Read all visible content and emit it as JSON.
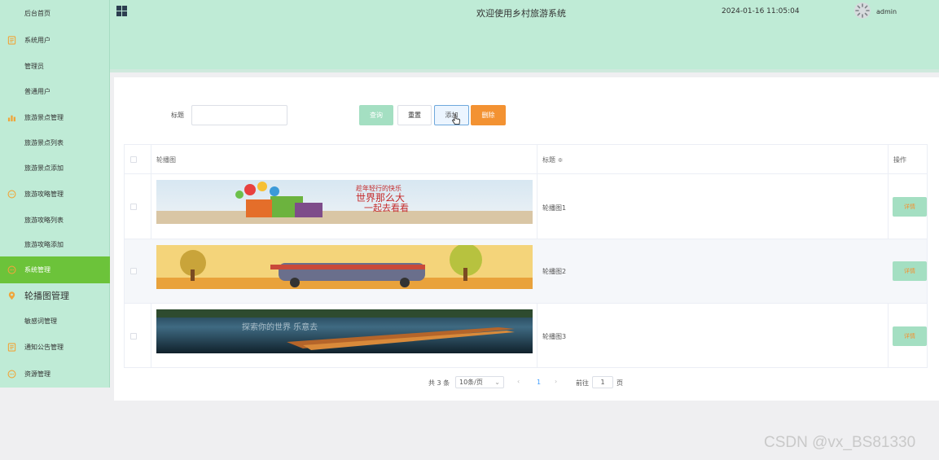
{
  "sidebar": {
    "items": [
      {
        "label": "后台首页",
        "icon": ""
      },
      {
        "label": "系统用户",
        "icon": "document-icon"
      },
      {
        "label": "管理员",
        "icon": ""
      },
      {
        "label": "普通用户",
        "icon": ""
      },
      {
        "label": "旅游景点管理",
        "icon": "bar-chart-icon"
      },
      {
        "label": "旅游景点列表",
        "icon": ""
      },
      {
        "label": "旅游景点添加",
        "icon": ""
      },
      {
        "label": "旅游攻略管理",
        "icon": "chat-icon"
      },
      {
        "label": "旅游攻略列表",
        "icon": ""
      },
      {
        "label": "旅游攻略添加",
        "icon": ""
      },
      {
        "label": "系统管理",
        "icon": "chat-icon"
      },
      {
        "label": "轮播图管理",
        "icon": "location-pin-icon"
      },
      {
        "label": "敏感词管理",
        "icon": ""
      },
      {
        "label": "通知公告管理",
        "icon": "document-icon"
      },
      {
        "label": "资源管理",
        "icon": "chat-icon"
      }
    ],
    "active_index": 10,
    "bg_color": "#bfebd6",
    "active_color": "#6cc33a"
  },
  "header": {
    "title": "欢迎使用乡村旅游系统",
    "datetime": "2024-01-16 11:05:04",
    "username": "admin"
  },
  "search": {
    "label": "标题",
    "value": "",
    "placeholder": ""
  },
  "toolbar": {
    "query_label": "查询",
    "reset_label": "重置",
    "add_label": "添加",
    "delete_label": "删除"
  },
  "table": {
    "columns": {
      "image": "轮播图",
      "title": "标题 ≑",
      "actions": "操作"
    },
    "rows": [
      {
        "title": "轮播图1",
        "action": "详情",
        "banner_text_1": "趁年轻行的快乐",
        "banner_text_2": "世界那么大",
        "banner_text_3": "一起去看看"
      },
      {
        "title": "轮播图2",
        "action": "详情"
      },
      {
        "title": "轮播图3",
        "action": "详情",
        "banner_text_1": "探索你的世界 乐意去"
      }
    ]
  },
  "pagination": {
    "total": "共 3 条",
    "page_size": "10条/页",
    "current_page": "1",
    "goto_label": "前往",
    "goto_value": "1",
    "page_suffix": "页"
  },
  "watermark": "CSDN @vx_BS81330"
}
